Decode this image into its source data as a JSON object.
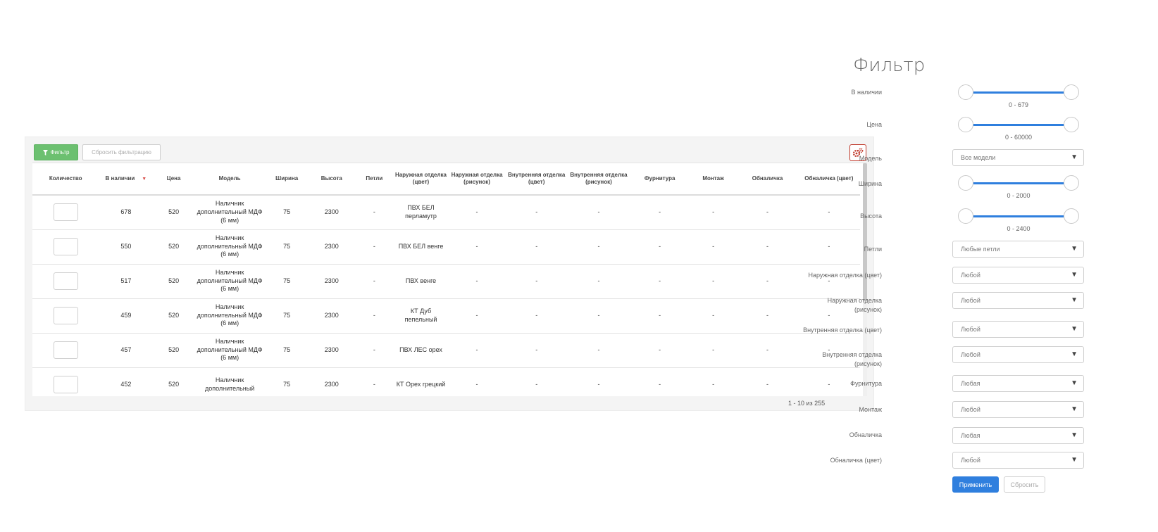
{
  "toolbar": {
    "filter_label": "Фильтр",
    "reset_filter_label": "Сбросить фильтрацию",
    "settings_icon": "gears-icon",
    "filter_icon": "funnel-icon"
  },
  "table": {
    "columns": [
      "Количество",
      "В наличии",
      "Цена",
      "Модель",
      "Ширина",
      "Высота",
      "Петли",
      "Наружная отделка (цвет)",
      "Наружная отделка (рисунок)",
      "Внутренняя отделка (цвет)",
      "Внутренняя отделка (рисунок)",
      "Фурнитура",
      "Монтаж",
      "Обналичка",
      "Обналичка (цвет)"
    ],
    "sort_indicator": "▼",
    "rows": [
      [
        "",
        "678",
        "520",
        "Наличник дополнительный МДФ (6 мм)",
        "75",
        "2300",
        "-",
        "ПВХ БЕЛ перламутр",
        "-",
        "-",
        "-",
        "-",
        "-",
        "-",
        "-"
      ],
      [
        "",
        "550",
        "520",
        "Наличник дополнительный МДФ (6 мм)",
        "75",
        "2300",
        "-",
        "ПВХ БЕЛ венге",
        "-",
        "-",
        "-",
        "-",
        "-",
        "-",
        "-"
      ],
      [
        "",
        "517",
        "520",
        "Наличник дополнительный МДФ (6 мм)",
        "75",
        "2300",
        "-",
        "ПВХ венге",
        "-",
        "-",
        "-",
        "-",
        "-",
        "-",
        "-"
      ],
      [
        "",
        "459",
        "520",
        "Наличник дополнительный МДФ (6 мм)",
        "75",
        "2300",
        "-",
        "КТ Дуб пепельный",
        "-",
        "-",
        "-",
        "-",
        "-",
        "-",
        "-"
      ],
      [
        "",
        "457",
        "520",
        "Наличник дополнительный МДФ (6 мм)",
        "75",
        "2300",
        "-",
        "ПВХ ЛЕС орех",
        "-",
        "-",
        "-",
        "-",
        "-",
        "-",
        "-"
      ],
      [
        "",
        "452",
        "520",
        "Наличник дополнительный",
        "75",
        "2300",
        "-",
        "КТ Орех грецкий",
        "-",
        "-",
        "-",
        "-",
        "-",
        "-",
        "-"
      ]
    ],
    "pager": "1 - 10 из 255"
  },
  "filter": {
    "title": "Фильтр",
    "in_stock": {
      "label": "В наличии",
      "range": "0 - 679",
      "min": 0,
      "max": 679
    },
    "price": {
      "label": "Цена",
      "range": "0 - 60000",
      "min": 0,
      "max": 60000
    },
    "model": {
      "label": "Модель",
      "value": "Все модели"
    },
    "width": {
      "label": "Ширина",
      "range": "0 - 2000",
      "min": 0,
      "max": 2000
    },
    "height": {
      "label": "Высота",
      "range": "0 - 2400",
      "min": 0,
      "max": 2400
    },
    "hinges": {
      "label": "Петли",
      "value": "Любые петли"
    },
    "outer_color": {
      "label": "Наружная отделка (цвет)",
      "value": "Любой"
    },
    "outer_pattern": {
      "label_line1": "Наружная отделка",
      "label_line2": "(рисунок)",
      "value": "Любой"
    },
    "inner_color": {
      "label": "Внутренняя отделка (цвет)",
      "value": "Любой"
    },
    "inner_pattern": {
      "label_line1": "Внутренняя отделка",
      "label_line2": "(рисунок)",
      "value": "Любой"
    },
    "fittings": {
      "label": "Фурнитура",
      "value": "Любая"
    },
    "mounting": {
      "label": "Монтаж",
      "value": "Любой"
    },
    "casing": {
      "label": "Обналичка",
      "value": "Любая"
    },
    "casing_color": {
      "label": "Обналичка (цвет)",
      "value": "Любой"
    },
    "apply_label": "Применить",
    "reset_label": "Сбросить",
    "caret": "▼"
  },
  "colors": {
    "filter_button": "#6cc070",
    "accent_blue": "#2f7fde",
    "settings_border": "#c0392b",
    "sort_arrow": "#d9534f"
  }
}
